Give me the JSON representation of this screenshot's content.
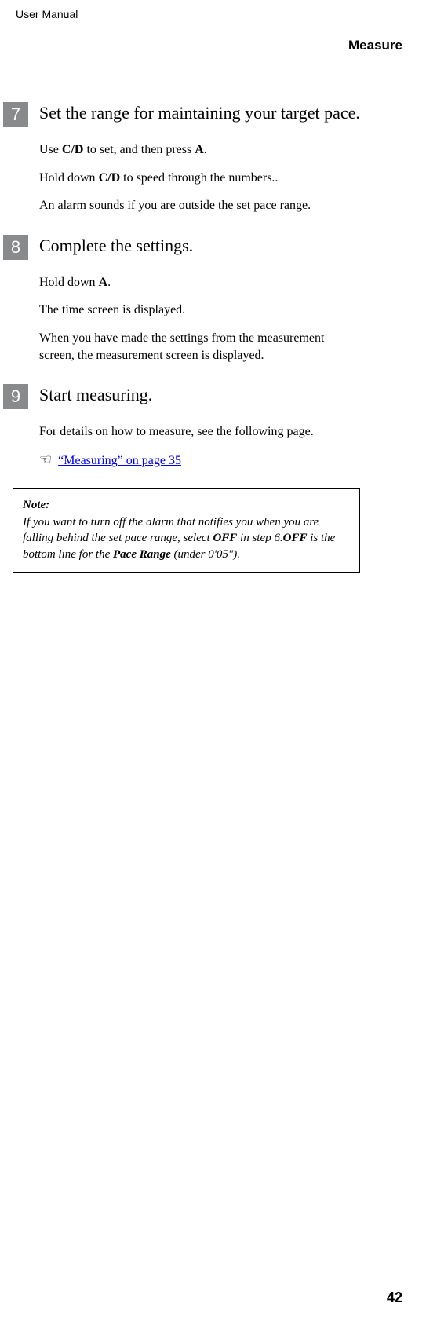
{
  "header": {
    "doc_title": "User Manual",
    "section": "Measure"
  },
  "steps": [
    {
      "num": "7",
      "title": "Set the range for maintaining your target pace.",
      "paras": [
        {
          "pre": "Use ",
          "bold1": "C/D",
          "mid": " to set, and then press ",
          "bold2": "A",
          "post": "."
        },
        {
          "pre": "Hold down ",
          "bold1": "C/D",
          "mid": " to speed through the numbers..",
          "bold2": "",
          "post": ""
        },
        {
          "pre": "An alarm sounds if you are outside the set pace range.",
          "bold1": "",
          "mid": "",
          "bold2": "",
          "post": ""
        }
      ]
    },
    {
      "num": "8",
      "title": "Complete the settings.",
      "paras": [
        {
          "pre": "Hold down ",
          "bold1": "A",
          "mid": ".",
          "bold2": "",
          "post": ""
        },
        {
          "pre": "The time screen is displayed.",
          "bold1": "",
          "mid": "",
          "bold2": "",
          "post": ""
        },
        {
          "pre": "When you have made the settings from the measurement screen, the measurement screen is displayed.",
          "bold1": "",
          "mid": "",
          "bold2": "",
          "post": ""
        }
      ]
    },
    {
      "num": "9",
      "title": "Start measuring.",
      "paras": [
        {
          "pre": "For details on how to measure, see the following page.",
          "bold1": "",
          "mid": "",
          "bold2": "",
          "post": ""
        }
      ]
    }
  ],
  "xref": {
    "icon": "☞",
    "text": "“Measuring” on page 35"
  },
  "note": {
    "title": "Note:",
    "pre": "If you want to turn off the alarm that notifies you when you are falling behind the set pace range, select ",
    "b1": "OFF",
    "mid1": " in step 6.",
    "b2": "OFF",
    "mid2": " is the bottom line for the ",
    "b3": "Pace Range",
    "post": " (under 0'05\")."
  },
  "page_number": "42"
}
